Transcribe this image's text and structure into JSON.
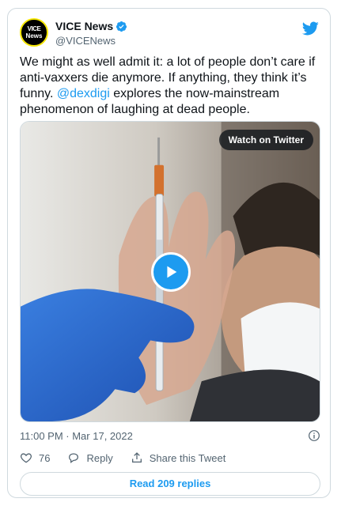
{
  "account": {
    "display_name": "VICE News",
    "handle": "@VICENews",
    "avatar_text_line1": "VICE",
    "avatar_text_line2": "News",
    "verified": true
  },
  "tweet": {
    "text_before": "We might as well admit it: a lot of people don’t care if anti-vaxxers die anymore. If anything, they think it’s funny. ",
    "mention": "@dexdigi",
    "text_after": " explores the now-mainstream phenomenon of laughing at dead people."
  },
  "media": {
    "watch_label": "Watch on Twitter",
    "type": "video"
  },
  "meta": {
    "timestamp": "11:00 PM · Mar 17, 2022"
  },
  "actions": {
    "like_count": "76",
    "reply_label": "Reply",
    "share_label": "Share this Tweet"
  },
  "footer": {
    "read_replies_label": "Read 209 replies"
  },
  "colors": {
    "accent": "#1d9bf0",
    "text": "#0f1419",
    "muted": "#536471",
    "border": "#cfd9de"
  }
}
